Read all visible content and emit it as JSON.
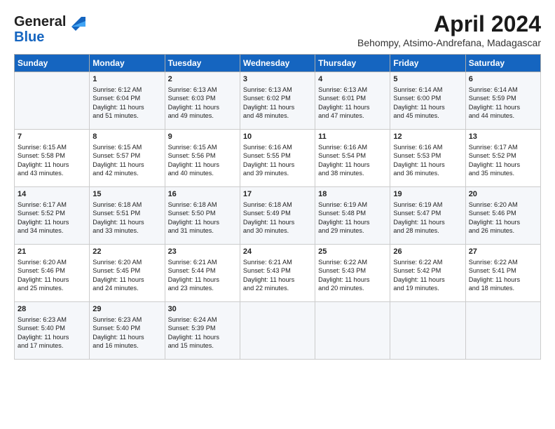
{
  "header": {
    "logo_line1": "General",
    "logo_line2": "Blue",
    "month": "April 2024",
    "location": "Behompy, Atsimo-Andrefana, Madagascar"
  },
  "days_of_week": [
    "Sunday",
    "Monday",
    "Tuesday",
    "Wednesday",
    "Thursday",
    "Friday",
    "Saturday"
  ],
  "weeks": [
    [
      {
        "day": "",
        "info": ""
      },
      {
        "day": "1",
        "info": "Sunrise: 6:12 AM\nSunset: 6:04 PM\nDaylight: 11 hours\nand 51 minutes."
      },
      {
        "day": "2",
        "info": "Sunrise: 6:13 AM\nSunset: 6:03 PM\nDaylight: 11 hours\nand 49 minutes."
      },
      {
        "day": "3",
        "info": "Sunrise: 6:13 AM\nSunset: 6:02 PM\nDaylight: 11 hours\nand 48 minutes."
      },
      {
        "day": "4",
        "info": "Sunrise: 6:13 AM\nSunset: 6:01 PM\nDaylight: 11 hours\nand 47 minutes."
      },
      {
        "day": "5",
        "info": "Sunrise: 6:14 AM\nSunset: 6:00 PM\nDaylight: 11 hours\nand 45 minutes."
      },
      {
        "day": "6",
        "info": "Sunrise: 6:14 AM\nSunset: 5:59 PM\nDaylight: 11 hours\nand 44 minutes."
      }
    ],
    [
      {
        "day": "7",
        "info": "Sunrise: 6:15 AM\nSunset: 5:58 PM\nDaylight: 11 hours\nand 43 minutes."
      },
      {
        "day": "8",
        "info": "Sunrise: 6:15 AM\nSunset: 5:57 PM\nDaylight: 11 hours\nand 42 minutes."
      },
      {
        "day": "9",
        "info": "Sunrise: 6:15 AM\nSunset: 5:56 PM\nDaylight: 11 hours\nand 40 minutes."
      },
      {
        "day": "10",
        "info": "Sunrise: 6:16 AM\nSunset: 5:55 PM\nDaylight: 11 hours\nand 39 minutes."
      },
      {
        "day": "11",
        "info": "Sunrise: 6:16 AM\nSunset: 5:54 PM\nDaylight: 11 hours\nand 38 minutes."
      },
      {
        "day": "12",
        "info": "Sunrise: 6:16 AM\nSunset: 5:53 PM\nDaylight: 11 hours\nand 36 minutes."
      },
      {
        "day": "13",
        "info": "Sunrise: 6:17 AM\nSunset: 5:52 PM\nDaylight: 11 hours\nand 35 minutes."
      }
    ],
    [
      {
        "day": "14",
        "info": "Sunrise: 6:17 AM\nSunset: 5:52 PM\nDaylight: 11 hours\nand 34 minutes."
      },
      {
        "day": "15",
        "info": "Sunrise: 6:18 AM\nSunset: 5:51 PM\nDaylight: 11 hours\nand 33 minutes."
      },
      {
        "day": "16",
        "info": "Sunrise: 6:18 AM\nSunset: 5:50 PM\nDaylight: 11 hours\nand 31 minutes."
      },
      {
        "day": "17",
        "info": "Sunrise: 6:18 AM\nSunset: 5:49 PM\nDaylight: 11 hours\nand 30 minutes."
      },
      {
        "day": "18",
        "info": "Sunrise: 6:19 AM\nSunset: 5:48 PM\nDaylight: 11 hours\nand 29 minutes."
      },
      {
        "day": "19",
        "info": "Sunrise: 6:19 AM\nSunset: 5:47 PM\nDaylight: 11 hours\nand 28 minutes."
      },
      {
        "day": "20",
        "info": "Sunrise: 6:20 AM\nSunset: 5:46 PM\nDaylight: 11 hours\nand 26 minutes."
      }
    ],
    [
      {
        "day": "21",
        "info": "Sunrise: 6:20 AM\nSunset: 5:46 PM\nDaylight: 11 hours\nand 25 minutes."
      },
      {
        "day": "22",
        "info": "Sunrise: 6:20 AM\nSunset: 5:45 PM\nDaylight: 11 hours\nand 24 minutes."
      },
      {
        "day": "23",
        "info": "Sunrise: 6:21 AM\nSunset: 5:44 PM\nDaylight: 11 hours\nand 23 minutes."
      },
      {
        "day": "24",
        "info": "Sunrise: 6:21 AM\nSunset: 5:43 PM\nDaylight: 11 hours\nand 22 minutes."
      },
      {
        "day": "25",
        "info": "Sunrise: 6:22 AM\nSunset: 5:43 PM\nDaylight: 11 hours\nand 20 minutes."
      },
      {
        "day": "26",
        "info": "Sunrise: 6:22 AM\nSunset: 5:42 PM\nDaylight: 11 hours\nand 19 minutes."
      },
      {
        "day": "27",
        "info": "Sunrise: 6:22 AM\nSunset: 5:41 PM\nDaylight: 11 hours\nand 18 minutes."
      }
    ],
    [
      {
        "day": "28",
        "info": "Sunrise: 6:23 AM\nSunset: 5:40 PM\nDaylight: 11 hours\nand 17 minutes."
      },
      {
        "day": "29",
        "info": "Sunrise: 6:23 AM\nSunset: 5:40 PM\nDaylight: 11 hours\nand 16 minutes."
      },
      {
        "day": "30",
        "info": "Sunrise: 6:24 AM\nSunset: 5:39 PM\nDaylight: 11 hours\nand 15 minutes."
      },
      {
        "day": "",
        "info": ""
      },
      {
        "day": "",
        "info": ""
      },
      {
        "day": "",
        "info": ""
      },
      {
        "day": "",
        "info": ""
      }
    ]
  ]
}
